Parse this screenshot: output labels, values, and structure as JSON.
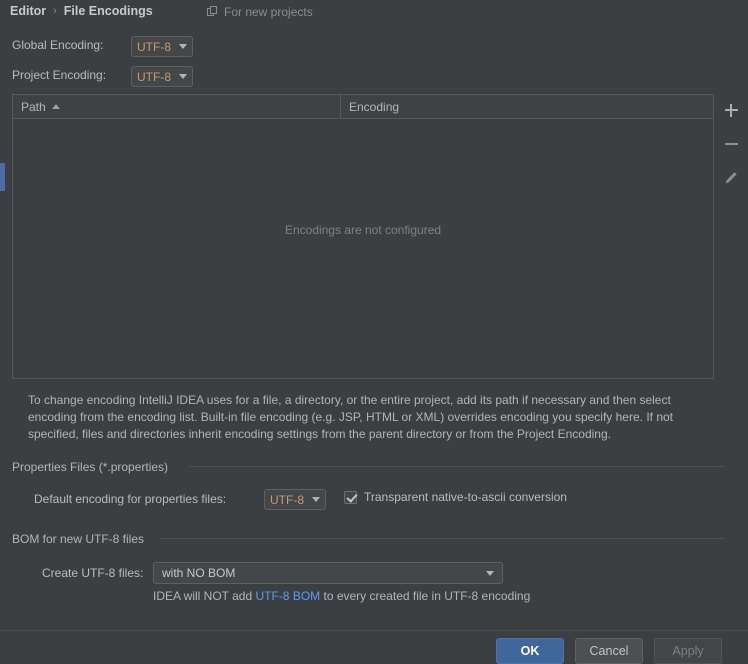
{
  "header": {
    "breadcrumb_parent": "Editor",
    "breadcrumb_sep": "›",
    "breadcrumb_current": "File Encodings",
    "for_new_projects": "For new projects",
    "copy_icon": "copy-icon"
  },
  "global_encoding": {
    "label": "Global Encoding:",
    "value": "UTF-8"
  },
  "project_encoding": {
    "label": "Project Encoding:",
    "value": "UTF-8"
  },
  "table": {
    "columns": [
      "Path",
      "Encoding"
    ],
    "sort_column": "Path",
    "sort_direction": "ascending",
    "rows": [],
    "empty_message": "Encodings are not configured",
    "tools": [
      {
        "name": "add-button",
        "icon": "plus-icon"
      },
      {
        "name": "remove-button",
        "icon": "minus-icon"
      },
      {
        "name": "edit-button",
        "icon": "pencil-icon"
      }
    ]
  },
  "description": "To change encoding IntelliJ IDEA uses for a file, a directory, or the entire project, add its path if necessary and then select encoding from the encoding list. Built-in file encoding (e.g. JSP, HTML or XML) overrides encoding you specify here. If not specified, files and directories inherit encoding settings from the parent directory or from the Project Encoding.",
  "properties_files": {
    "group_title": "Properties Files (*.properties)",
    "default_encoding_label": "Default encoding for properties files:",
    "default_encoding_value": "UTF-8",
    "transparent_checkbox_label": "Transparent native-to-ascii conversion",
    "transparent_checked": true
  },
  "bom": {
    "group_title": "BOM for new UTF-8 files",
    "create_label": "Create UTF-8 files:",
    "create_value": "with NO BOM",
    "hint_before": "IDEA will NOT add ",
    "hint_link": "UTF-8 BOM",
    "hint_after": " to every created file in UTF-8 encoding"
  },
  "footer": {
    "ok": "OK",
    "cancel": "Cancel",
    "apply": "Apply"
  },
  "colors": {
    "background": "#3c3f41",
    "accent_blue": "#40679b",
    "link_blue": "#589df6",
    "value_orange": "#cc9a67",
    "annotation_red": "#fe1c00"
  }
}
